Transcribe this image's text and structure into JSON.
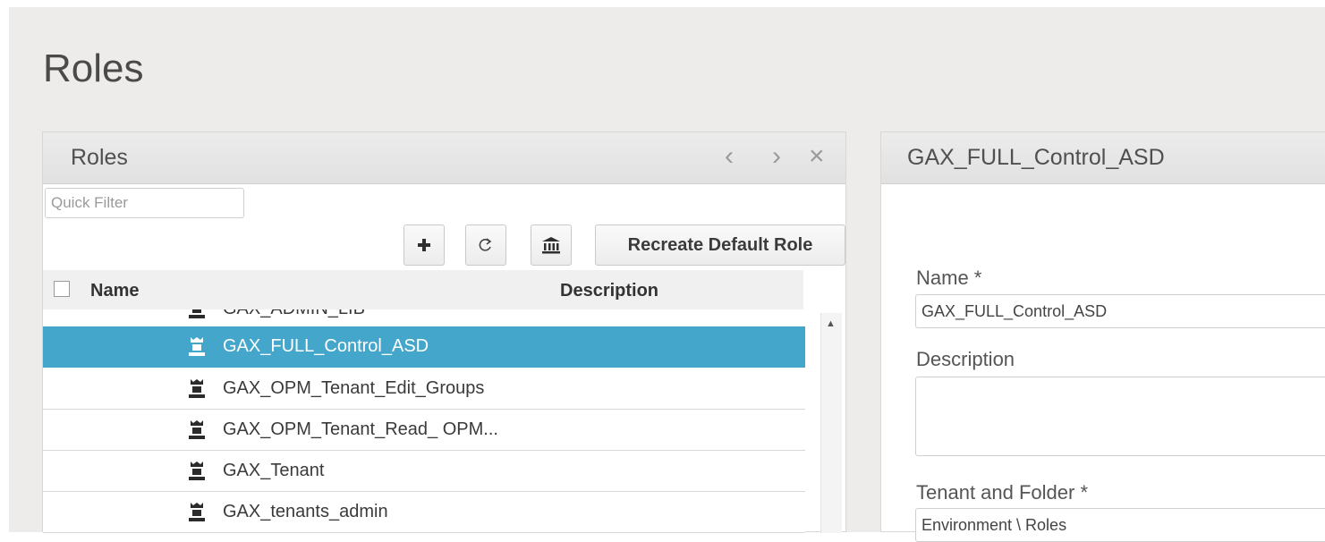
{
  "page": {
    "title": "Roles"
  },
  "left_panel": {
    "title": "Roles",
    "controls": {
      "prev": "‹",
      "next": "›",
      "close": "×"
    },
    "quick_filter": {
      "placeholder": "Quick Filter",
      "value": ""
    },
    "toolbar": {
      "add_icon": "plus-icon",
      "refresh_icon": "refresh-icon",
      "bank_icon": "building-icon",
      "recreate_label": "Recreate Default Role"
    },
    "columns": {
      "name": "Name",
      "description": "Description"
    },
    "rows": [
      {
        "name": "GAX_ADMIN_LIB",
        "selected": false
      },
      {
        "name": "GAX_FULL_Control_ASD",
        "selected": true
      },
      {
        "name": "GAX_OPM_Tenant_Edit_Groups",
        "selected": false
      },
      {
        "name": "GAX_OPM_Tenant_Read_ OPM...",
        "selected": false
      },
      {
        "name": "GAX_Tenant",
        "selected": false
      },
      {
        "name": "GAX_tenants_admin",
        "selected": false
      }
    ]
  },
  "right_panel": {
    "title": "GAX_FULL_Control_ASD",
    "name_label": "Name *",
    "name_value": "GAX_FULL_Control_ASD",
    "description_label": "Description",
    "description_value": "",
    "tenant_label": "Tenant and Folder *",
    "tenant_value": "Environment \\ Roles"
  },
  "colors": {
    "accent": "#45a6cc",
    "background": "#edecea"
  }
}
